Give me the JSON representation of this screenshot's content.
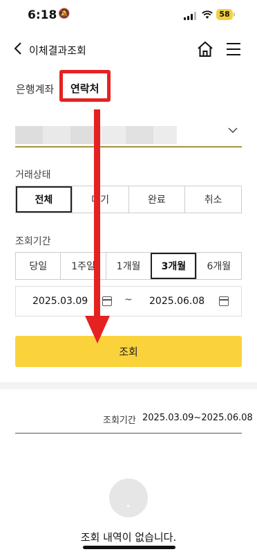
{
  "status_bar": {
    "time": "6:18",
    "battery": "58"
  },
  "header": {
    "title": "이체결과조회"
  },
  "tabs": [
    {
      "label": "은행계좌"
    },
    {
      "label": "연락처"
    }
  ],
  "filters": {
    "status_label": "거래상태",
    "status_options": [
      "전체",
      "대기",
      "완료",
      "취소"
    ],
    "status_selected": "전체",
    "period_label": "조회기간",
    "period_options": [
      "당일",
      "1주일",
      "1개월",
      "3개월",
      "6개월"
    ],
    "period_selected": "3개월",
    "start_date": "2025.03.09",
    "end_date": "2025.06.08",
    "separator": "~"
  },
  "search_button": "조회",
  "results": {
    "period_label": "조회기간",
    "period_value": "2025.03.09~2025.06.08",
    "empty_message": "조회 내역이 없습니다."
  },
  "colors": {
    "accent": "#fad23c",
    "highlight": "#e52222",
    "underline": "#a8903c"
  }
}
